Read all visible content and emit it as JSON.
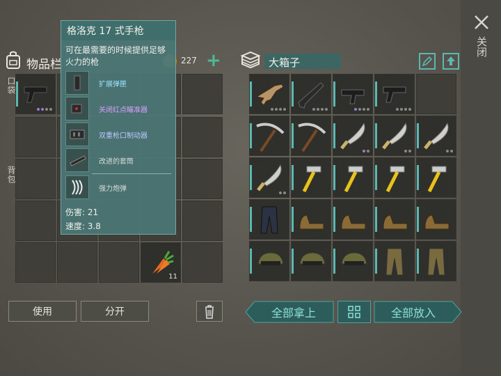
{
  "close_label": "关闭",
  "inventory": {
    "title": "物品栏",
    "pocket_label": "口袋",
    "backpack_label": "背包",
    "coin_count": "227",
    "carrot_count": "11"
  },
  "tooltip": {
    "title": "格洛克 17 式手枪",
    "description": "可在最需要的时候提供足够火力的枪",
    "mods": [
      {
        "label": "扩展弹匣",
        "color": "#9be3ff",
        "icon": "magazine-icon"
      },
      {
        "label": "关闭红点瞄准器",
        "color": "#d8a0ff",
        "icon": "red-dot-sight-icon"
      },
      {
        "label": "双重枪口制动器",
        "color": "#b9c8ff",
        "icon": "muzzle-brake-icon"
      },
      {
        "label": "改进的套筒",
        "color": "#d8dcd6",
        "icon": "slide-icon"
      }
    ],
    "ammo_label": "强力炮弹",
    "damage": "伤害: 21",
    "speed": "速度: 3.8"
  },
  "buttons": {
    "use": "使用",
    "split": "分开",
    "take_all": "全部拿上",
    "put_all": "全部放入"
  },
  "box": {
    "title": "大箱子"
  },
  "colors": {
    "accent": "#5bb8b2",
    "teal_button": "#2c5d5a",
    "tooltip_bg": "#4a7676",
    "rare_dot": "#9b7ad8"
  },
  "box_items": [
    "rifle-icon",
    "shotgun-icon",
    "smg-icon",
    "pistol-icon",
    "empty",
    "pickaxe-icon",
    "pickaxe-icon",
    "machete-icon",
    "machete-icon",
    "machete-icon",
    "machete-icon",
    "hammer-icon",
    "hammer-icon",
    "hammer-icon",
    "hammer-icon",
    "pants-icon",
    "boots-icon",
    "boots-icon",
    "boots-icon",
    "boots-icon",
    "cap-icon",
    "cap-icon",
    "cap-icon",
    "camo-pants-icon",
    "camo-pants-icon"
  ]
}
